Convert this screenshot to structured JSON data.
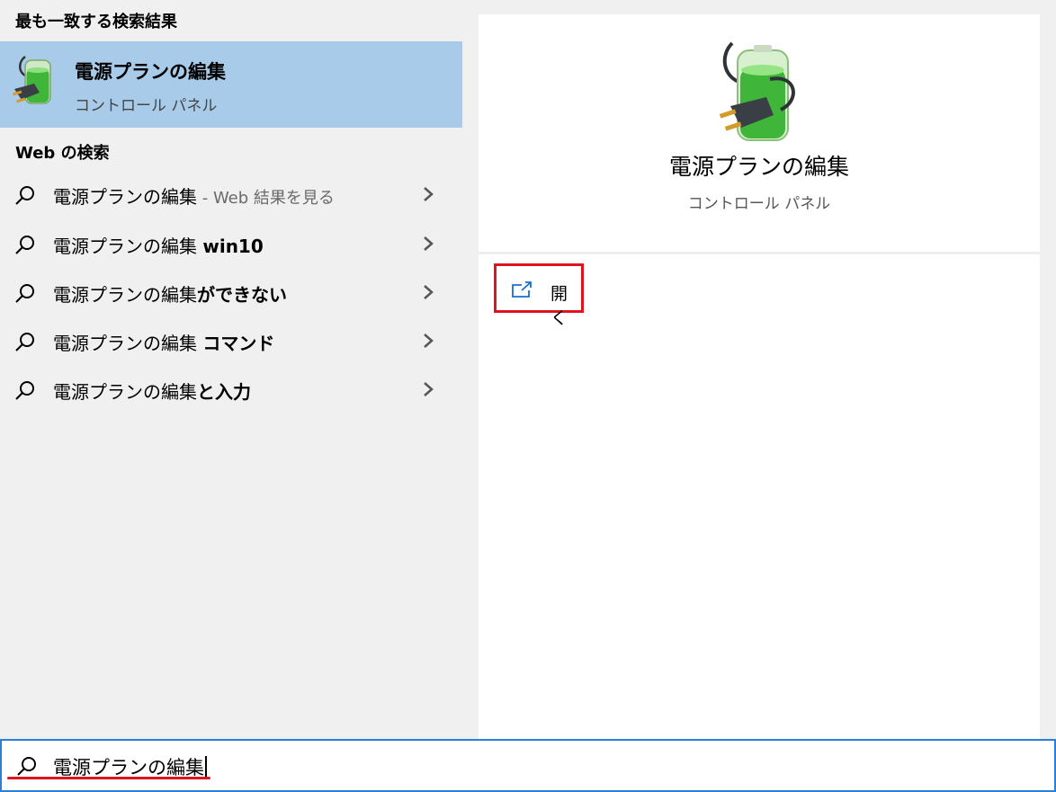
{
  "best_match": {
    "header": "最も一致する検索結果",
    "title": "電源プランの編集",
    "subtitle": "コントロール パネル",
    "icon": "battery-plug-icon"
  },
  "web_search": {
    "header": "Web の検索",
    "items": [
      {
        "text": "電源プランの編集",
        "bold_suffix": "",
        "grey_suffix": " - Web 結果を見る"
      },
      {
        "text": "電源プランの編集 ",
        "bold_suffix": "win10",
        "grey_suffix": ""
      },
      {
        "text": "電源プランの編集",
        "bold_suffix": "ができない",
        "grey_suffix": ""
      },
      {
        "text": "電源プランの編集 ",
        "bold_suffix": "コマンド",
        "grey_suffix": ""
      },
      {
        "text": "電源プランの編集",
        "bold_suffix": "と入力",
        "grey_suffix": ""
      }
    ]
  },
  "preview": {
    "title": "電源プランの編集",
    "subtitle": "コントロール パネル",
    "action_label": "開く",
    "action_icon": "open-external-icon"
  },
  "search": {
    "value": "電源プランの編集",
    "icon": "search-icon"
  },
  "colors": {
    "selection": "#a9cbea",
    "panel_bg": "#f0f0f0",
    "highlight_red": "#e0141e",
    "accent_blue": "#2b7fd8"
  }
}
